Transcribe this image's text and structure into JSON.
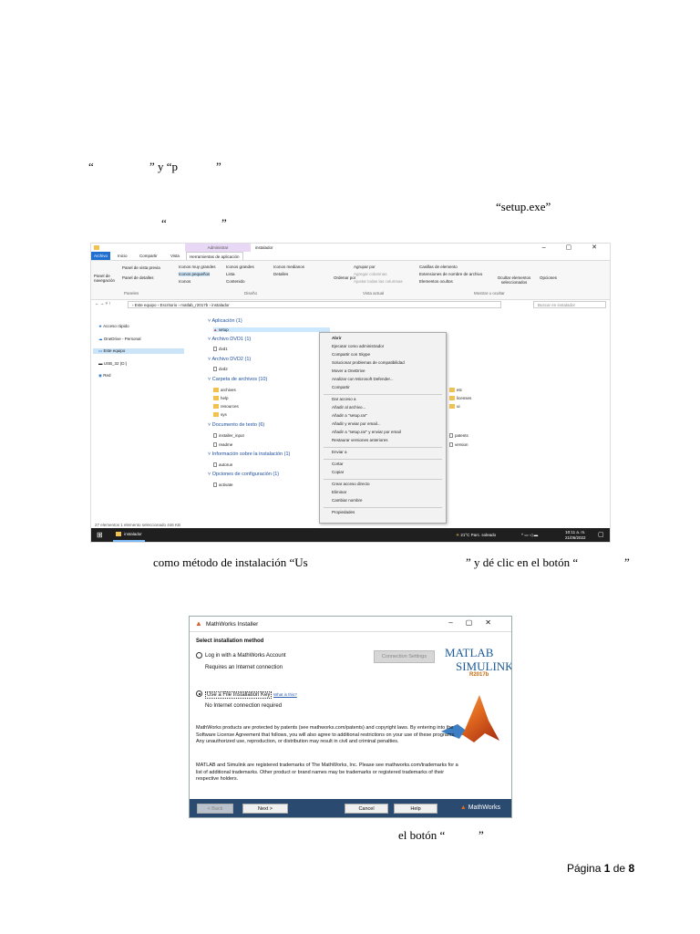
{
  "doc": {
    "quote_line_1a": "“",
    "quote_line_1b": "” y “p",
    "quote_line_1c": "”",
    "setup_ref": "“setup.exe”",
    "quote_line_3a": "“",
    "quote_line_3b": "”",
    "install_method_text_a": "como método de instalación “Us",
    "install_method_text_b": "” y dé clic en el botón “",
    "install_method_text_c": "”",
    "button_ref_a": "el botón “",
    "button_ref_b": "”",
    "page_label": "Página",
    "page_number": "1",
    "page_of": "de",
    "page_total": "8"
  },
  "explorer": {
    "app_tools_tab": "Administrar",
    "window_title": "instalador",
    "window_buttons": "–  ▢  ✕",
    "tabs": [
      "Archivo",
      "Inicio",
      "Compartir",
      "Vista",
      "Herramientas de aplicación"
    ],
    "ribbon": {
      "nav_pane": "Panel de navegación",
      "preview_pane": "Panel de vista previa",
      "details_pane": "Panel de detalles",
      "panes_group": "Paneles",
      "layout_items": [
        "Iconos muy grandes",
        "Iconos grandes",
        "Iconos medianos",
        "Iconos pequeños",
        "Lista",
        "Detalles",
        "Iconos",
        "Contenido"
      ],
      "layout_group": "Diseño",
      "sort_by": "Ordenar por",
      "group_by": "Agrupar por",
      "add_columns": "Agregar columnas",
      "fit_columns": "Ajustar todas las columnas",
      "current_view_group": "Vista actual",
      "checkboxes": [
        "Casillas de elemento",
        "Extensiones de nombre de archivo",
        "Elementos ocultos"
      ],
      "hide_selected": "Ocultar elementos seleccionados",
      "options": "Opciones",
      "show_hide_group": "Mostrar u ocultar"
    },
    "address": "› Este equipo › Escritorio › matlab_r2017b › instalador",
    "search_placeholder": "Buscar en instalador",
    "nav_items": [
      "Acceso rápido",
      "OneDrive - Personal",
      "Este equipo",
      "USB_32 (D:)",
      "Red"
    ],
    "groups": [
      {
        "title": "Aplicación (1)",
        "files": [
          "setup"
        ]
      },
      {
        "title": "Archivo DVD1 (1)",
        "files": [
          "dvd1"
        ]
      },
      {
        "title": "Archivo DVD2 (1)",
        "files": [
          "dvd2"
        ]
      },
      {
        "title": "Carpeta de archivos (10)",
        "files": [
          "archives",
          "help",
          "resources",
          "sys",
          "etc",
          "licenses",
          "ui"
        ]
      },
      {
        "title": "Documento de texto (6)",
        "files": [
          "installer_input",
          "readme",
          "patents",
          "version"
        ]
      },
      {
        "title": "Información sobre la instalación (1)",
        "files": [
          "autorun"
        ]
      },
      {
        "title": "Opciones de configuración (1)",
        "files": [
          "activate"
        ]
      }
    ],
    "context_menu": [
      "Abrir",
      "Ejecutar como administrador",
      "Compartir con Skype",
      "Solucionar problemas de compatibilidad",
      "Mover a OneDrive",
      "Analizar con Microsoft Defender...",
      "Compartir",
      "Dar acceso a",
      "Añadir al archivo...",
      "Añadir a \"setup.rar\"",
      "Añadir y enviar por email...",
      "Añadir a \"setup.rar\" y enviar por email",
      "Restaurar versiones anteriores",
      "Enviar a",
      "Cortar",
      "Copiar",
      "Crear acceso directo",
      "Eliminar",
      "Cambiar nombre",
      "Propiedades"
    ],
    "status": "27 elementos    1 elemento seleccionado  446 KB",
    "taskbar": {
      "app": "instalador",
      "weather": "21°C  Parc. soleado",
      "time": "10:11 a. m.",
      "date": "21/06/2022"
    }
  },
  "installer": {
    "title": "MathWorks Installer",
    "heading": "Select installation method",
    "option1": "Log in with a MathWorks Account",
    "option1_note": "Requires an Internet connection",
    "connection_settings": "Connection Settings",
    "option2": "Use a File Installation Key",
    "whats_this": "What is this?",
    "option2_note": "No Internet connection required",
    "para1": "MathWorks products are protected by patents (see mathworks.com/patents) and copyright laws. By entering into the Software License Agreement that follows, you will also agree to additional restrictions on your use of these programs. Any unauthorized use, reproduction, or distribution may result in civil and criminal penalties.",
    "para2": "MATLAB and Simulink are registered trademarks of The MathWorks, Inc. Please see mathworks.com/trademarks for a list of additional trademarks. Other product or brand names may be trademarks or registered trademarks of their respective holders.",
    "brand_line1": "MATLAB",
    "brand_line2": "SIMULINK",
    "release": "R2017b",
    "back": "< Back",
    "next": "Next >",
    "cancel": "Cancel",
    "help": "Help",
    "logo": "MathWorks"
  }
}
